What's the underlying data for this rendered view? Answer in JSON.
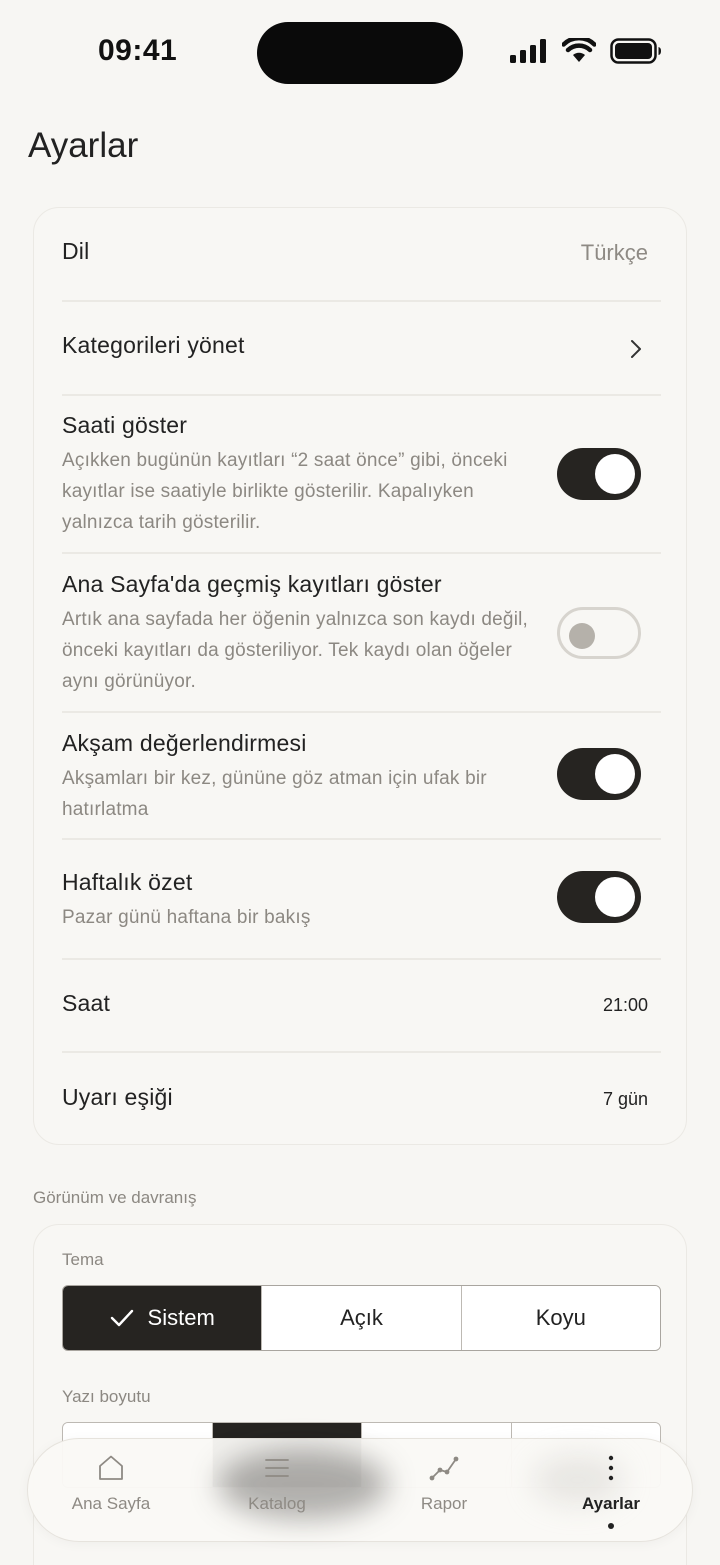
{
  "status_bar": {
    "time": "09:41"
  },
  "page": {
    "title": "Ayarlar"
  },
  "settings": {
    "language": {
      "label": "Dil",
      "value": "Türkçe"
    },
    "categories": {
      "label": "Kategorileri yönet"
    },
    "show_time": {
      "label": "Saati göster",
      "description": "Açıkken bugünün kayıtları “2 saat önce” gibi, önceki kayıtlar ise saatiyle birlikte gösterilir. Kapalıyken yalnızca tarih gösterilir.",
      "enabled": true
    },
    "show_history": {
      "label": "Ana Sayfa'da geçmiş kayıtları göster",
      "description": "Artık ana sayfada her öğenin yalnızca son kaydı değil, önceki kayıtları da gösteriliyor. Tek kaydı olan öğeler aynı görünüyor.",
      "enabled": false
    },
    "evening_review": {
      "label": "Akşam değerlendirmesi",
      "description": "Akşamları bir kez, gününe göz atman için ufak bir hatırlatma",
      "enabled": true
    },
    "weekly_summary": {
      "label": "Haftalık özet",
      "description": "Pazar günü haftana bir bakış",
      "enabled": true
    },
    "time": {
      "label": "Saat",
      "value": "21:00"
    },
    "warning_threshold": {
      "label": "Uyarı eşiği",
      "value": "7 gün"
    }
  },
  "appearance": {
    "section_label": "Görünüm ve davranış",
    "theme": {
      "label": "Tema",
      "options": [
        "Sistem",
        "Açık",
        "Koyu"
      ],
      "selected": "Sistem"
    },
    "font_size": {
      "label": "Yazı boyutu",
      "selected_index": 1
    }
  },
  "tabbar": {
    "tabs": [
      {
        "label": "Ana Sayfa",
        "icon": "home-icon"
      },
      {
        "label": "Katalog",
        "icon": "list-icon"
      },
      {
        "label": "Rapor",
        "icon": "chart-line-icon"
      },
      {
        "label": "Ayarlar",
        "icon": "more-vertical-icon"
      }
    ],
    "active": "Ayarlar"
  },
  "colors": {
    "background": "#f7f6f3",
    "accent_dark": "#262421",
    "muted_text": "#8c8882"
  }
}
